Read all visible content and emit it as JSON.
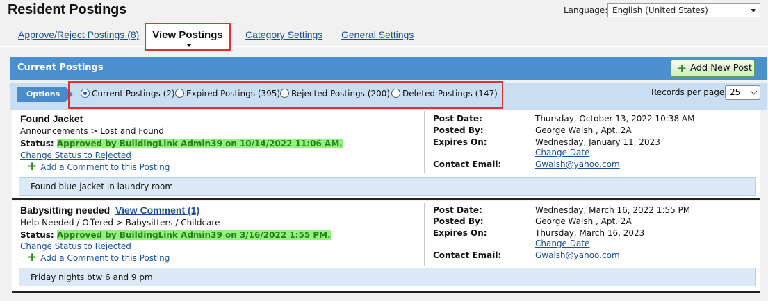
{
  "page": {
    "title": "Resident Postings"
  },
  "language": {
    "label": "Language:",
    "value": "English (United States)"
  },
  "tabs": [
    {
      "label": "Approve/Reject Postings (8)"
    },
    {
      "label": "View Postings"
    },
    {
      "label": "Category Settings"
    },
    {
      "label": "General Settings"
    }
  ],
  "section": {
    "title": "Current Postings",
    "add_button": "Add New Post"
  },
  "options": {
    "tag": "Options",
    "filters": [
      {
        "label": "Current Postings (2)",
        "selected": true
      },
      {
        "label": "Expired Postings (395)",
        "selected": false
      },
      {
        "label": "Rejected Postings (200)",
        "selected": false
      },
      {
        "label": "Deleted Postings (147)",
        "selected": false
      }
    ],
    "records_label": "Records per page:",
    "records_value": "25"
  },
  "postings": [
    {
      "title": "Found Jacket",
      "view_comment": "",
      "category": "Announcements > Lost and Found",
      "status_label": "Status:",
      "status_value": "Approved by BuildingLink Admin39 on 10/14/2022 11:06 AM.",
      "change_status": "Change Status to Rejected",
      "add_comment": "Add a Comment to this Posting",
      "post_date_label": "Post Date:",
      "post_date": "Thursday, October 13, 2022 10:38 AM",
      "posted_by_label": "Posted By:",
      "posted_by": "George Walsh , Apt. 2A",
      "expires_label": "Expires On:",
      "expires_on": "Wednesday, January 11, 2023",
      "change_date": "Change Date",
      "contact_label": "Contact Email:",
      "contact_email": "Gwalsh@yahoo.com",
      "message": "Found blue jacket in laundry room"
    },
    {
      "title": "Babysitting needed",
      "view_comment": "View  Comment (1)",
      "category": "Help Needed / Offered > Babysitters / Childcare",
      "status_label": "Status:",
      "status_value": "Approved by BuildingLink Admin39 on 3/16/2022 1:55 PM.",
      "change_status": "Change Status to Rejected",
      "add_comment": "Add a Comment to this Posting",
      "post_date_label": "Post Date:",
      "post_date": "Wednesday, March 16, 2022 1:55 PM",
      "posted_by_label": "Posted By:",
      "posted_by": "George Walsh , Apt. 2A",
      "expires_label": "Expires On:",
      "expires_on": "Thursday, March 16, 2023",
      "change_date": "Change Date",
      "contact_label": "Contact Email:",
      "contact_email": "Gwalsh@yahoo.com",
      "message": "Friday nights btw 6 and 9 pm"
    }
  ]
}
